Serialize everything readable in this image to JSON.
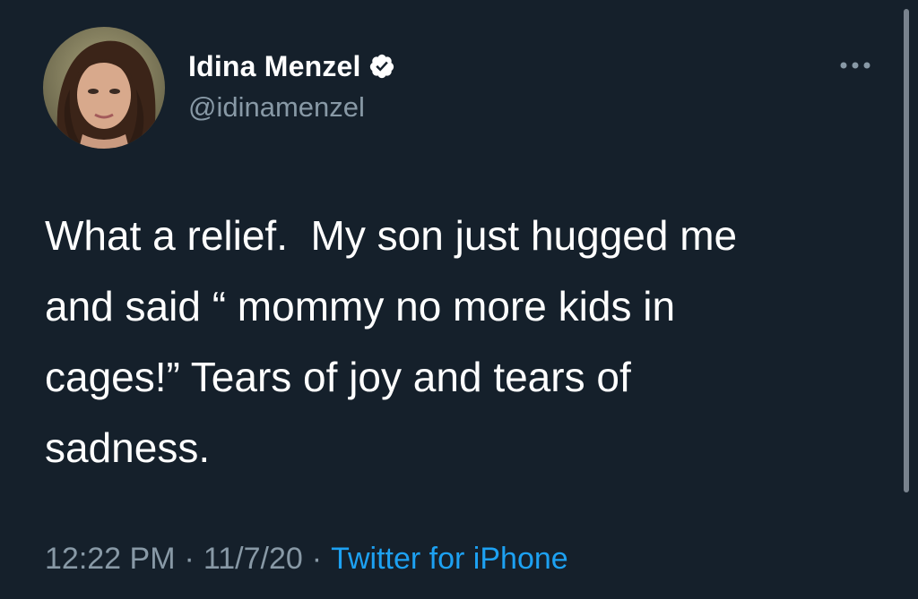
{
  "tweet": {
    "display_name": "Idina Menzel",
    "handle": "@idinamenzel",
    "verified": true,
    "text": "What a relief.  My son just hugged me\nand said “ mommy no more kids in\ncages!” Tears of joy and tears of\nsadness.",
    "time": "12:22 PM",
    "date": "11/7/20",
    "separator": "·",
    "source": "Twitter for iPhone"
  },
  "icons": {
    "verified": "verified-badge-icon",
    "more": "more-options-icon"
  },
  "colors": {
    "background": "#15202b",
    "text": "#ffffff",
    "secondary": "#8899a6",
    "link": "#1da1f2"
  }
}
